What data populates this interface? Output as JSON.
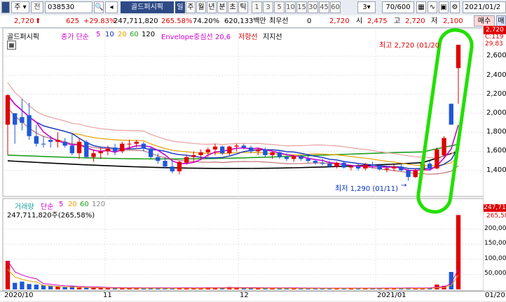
{
  "toolbar": {
    "chart_type": "주",
    "prefix": "전",
    "code": "038530",
    "stock_name": "골드퍼시픽",
    "periods": [
      "일",
      "주",
      "월",
      "년",
      "분",
      "초",
      "틱"
    ],
    "numbers": [
      "1",
      "3",
      "5",
      "10",
      "15",
      "30",
      "45",
      "60"
    ],
    "count_select": "3",
    "view_count": "70/600",
    "date_field": "2021/01/2"
  },
  "info": {
    "price": "2,720",
    "change": "625",
    "change_pct": "+29.83%",
    "volume": "247,711,820",
    "vol_ratio": "265.58%",
    "turnover": "74.20%",
    "amount": "620,133백만",
    "pref_label": "최우선",
    "pref_value": "0",
    "best_price": "2,720",
    "open_label": "시",
    "open": "2,475",
    "high_label": "고",
    "high": "2,720",
    "low_label": "저",
    "low": "2,100",
    "buy": "매수",
    "sell": "매"
  },
  "legend": {
    "stock": "골드퍼시픽",
    "ma_label": "종가 단순",
    "ma_periods": [
      "5",
      "10",
      "20",
      "60",
      "120"
    ],
    "envelope": "Envelope중심선 20,6",
    "resistance": "저항선",
    "support": "지지선"
  },
  "annotations": {
    "high": "최고 2,720 (01/20",
    "low": "최저 1,290 (01/11)"
  },
  "volume_legend": {
    "label": "거래량",
    "ma_label": "단순",
    "periods": [
      "5",
      "20",
      "60",
      "120"
    ],
    "value": "247,711,820주(265,58%)"
  },
  "price_axis": {
    "current_box": "2,720",
    "top_label": "C:119",
    "sub_label": "29.83",
    "ticks": [
      "2,600",
      "2,400",
      "2,200",
      "2,000",
      "1,800",
      "1,600",
      "1,400"
    ]
  },
  "volume_axis": {
    "current_box": "247,71",
    "sub_label": "265,58",
    "ticks": [
      "200,000",
      "150,000",
      "100,000",
      "50,000"
    ]
  },
  "x_axis": {
    "labels": [
      "2020/10",
      "11",
      "12",
      "2021/01",
      "01/20"
    ]
  },
  "colors": {
    "up": "#e00000",
    "down": "#1f57d6",
    "highlight": "#22e000",
    "ma5": "#d000d0",
    "ma10": "#1030c0",
    "ma20": "#e8a000",
    "ma60": "#20a020",
    "ma120": "#000000"
  },
  "chart_data": {
    "type": "candlestick",
    "y_range": [
      1170,
      2860
    ],
    "volume_range": [
      0,
      260000
    ],
    "candles": [
      [
        1880,
        2200,
        1560,
        2190,
        1
      ],
      [
        1880,
        2000,
        1680,
        2000,
        -1
      ],
      [
        1960,
        2150,
        1820,
        1900,
        -1
      ],
      [
        1980,
        2110,
        1720,
        1760,
        -1
      ],
      [
        1760,
        1880,
        1650,
        1680,
        -1
      ],
      [
        1680,
        1760,
        1640,
        1680,
        -1
      ],
      [
        1700,
        1760,
        1640,
        1720,
        -1
      ],
      [
        1720,
        1800,
        1640,
        1700,
        1
      ],
      [
        1700,
        1740,
        1640,
        1660,
        -1
      ],
      [
        1660,
        1780,
        1560,
        1580,
        -1
      ],
      [
        1580,
        1740,
        1520,
        1700,
        1
      ],
      [
        1700,
        1720,
        1530,
        1540,
        -1
      ],
      [
        1540,
        1620,
        1490,
        1580,
        1
      ],
      [
        1580,
        1640,
        1520,
        1600,
        1
      ],
      [
        1600,
        1660,
        1560,
        1630,
        1
      ],
      [
        1640,
        1680,
        1560,
        1600,
        -1
      ],
      [
        1600,
        1700,
        1580,
        1680,
        1
      ],
      [
        1680,
        1720,
        1620,
        1680,
        1
      ],
      [
        1680,
        1720,
        1640,
        1700,
        1
      ],
      [
        1680,
        1700,
        1600,
        1630,
        -1
      ],
      [
        1630,
        1650,
        1520,
        1540,
        -1
      ],
      [
        1540,
        1580,
        1470,
        1500,
        -1
      ],
      [
        1500,
        1540,
        1420,
        1440,
        -1
      ],
      [
        1440,
        1520,
        1370,
        1390,
        -1
      ],
      [
        1390,
        1500,
        1360,
        1490,
        1
      ],
      [
        1480,
        1560,
        1460,
        1540,
        1
      ],
      [
        1540,
        1600,
        1480,
        1560,
        1
      ],
      [
        1560,
        1620,
        1520,
        1590,
        1
      ],
      [
        1590,
        1640,
        1540,
        1620,
        1
      ],
      [
        1620,
        1680,
        1560,
        1650,
        1
      ],
      [
        1650,
        1660,
        1560,
        1580,
        -1
      ],
      [
        1580,
        1660,
        1560,
        1650,
        1
      ],
      [
        1650,
        1680,
        1600,
        1660,
        1
      ],
      [
        1660,
        1680,
        1620,
        1640,
        -1
      ],
      [
        1640,
        1660,
        1580,
        1600,
        -1
      ],
      [
        1600,
        1640,
        1560,
        1620,
        1
      ],
      [
        1620,
        1640,
        1540,
        1560,
        -1
      ],
      [
        1560,
        1600,
        1520,
        1590,
        1
      ],
      [
        1590,
        1600,
        1520,
        1540,
        -1
      ],
      [
        1540,
        1580,
        1500,
        1520,
        -1
      ],
      [
        1520,
        1560,
        1490,
        1550,
        1
      ],
      [
        1550,
        1560,
        1500,
        1520,
        -1
      ],
      [
        1520,
        1550,
        1480,
        1500,
        -1
      ],
      [
        1500,
        1520,
        1460,
        1480,
        -1
      ],
      [
        1480,
        1520,
        1450,
        1470,
        -1
      ],
      [
        1470,
        1500,
        1430,
        1440,
        -1
      ],
      [
        1440,
        1490,
        1420,
        1480,
        1
      ],
      [
        1480,
        1500,
        1420,
        1430,
        -1
      ],
      [
        1430,
        1460,
        1400,
        1440,
        1
      ],
      [
        1440,
        1470,
        1400,
        1420,
        -1
      ],
      [
        1420,
        1480,
        1400,
        1460,
        1
      ],
      [
        1460,
        1490,
        1420,
        1450,
        -1
      ],
      [
        1450,
        1470,
        1400,
        1410,
        -1
      ],
      [
        1410,
        1440,
        1380,
        1420,
        1
      ],
      [
        1420,
        1460,
        1390,
        1440,
        1
      ],
      [
        1440,
        1460,
        1390,
        1400,
        -1
      ],
      [
        1400,
        1420,
        1290,
        1330,
        -1
      ],
      [
        1330,
        1420,
        1320,
        1400,
        1
      ],
      [
        1400,
        1480,
        1380,
        1470,
        1
      ],
      [
        1470,
        1500,
        1400,
        1420,
        -1
      ],
      [
        1420,
        1640,
        1410,
        1620,
        1
      ],
      [
        1560,
        1760,
        1520,
        1740,
        1
      ],
      [
        2100,
        2100,
        1880,
        1880,
        -1
      ],
      [
        2475,
        2720,
        2100,
        2720,
        1
      ]
    ],
    "volume": [
      95000,
      22000,
      26000,
      18000,
      16000,
      14000,
      12000,
      10000,
      9000,
      11000,
      8000,
      7000,
      6500,
      6000,
      5500,
      5000,
      6000,
      5500,
      5000,
      4500,
      5000,
      6000,
      5000,
      4500,
      6000,
      5500,
      5000,
      4500,
      7000,
      6000,
      5500,
      8000,
      6000,
      5000,
      4500,
      5000,
      6000,
      5500,
      5000,
      4800,
      4500,
      5000,
      4500,
      4200,
      4000,
      4500,
      5000,
      4500,
      4200,
      4000,
      4500,
      4200,
      4800,
      5000,
      4500,
      4200,
      6000,
      5500,
      5000,
      6000,
      16000,
      12000,
      58000,
      247000
    ]
  }
}
